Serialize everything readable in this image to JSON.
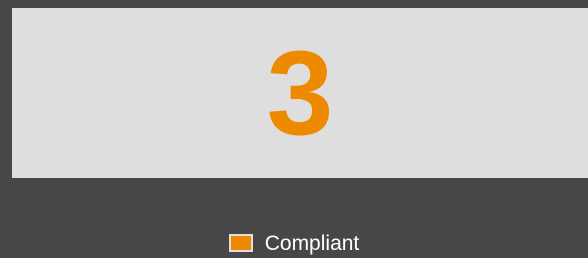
{
  "widget": {
    "value": "3",
    "value_color": "#ee8a00",
    "panel_color": "#dedede",
    "background_color": "#474747"
  },
  "legend": {
    "items": [
      {
        "label": "Compliant",
        "color": "#ee8a00"
      }
    ]
  }
}
